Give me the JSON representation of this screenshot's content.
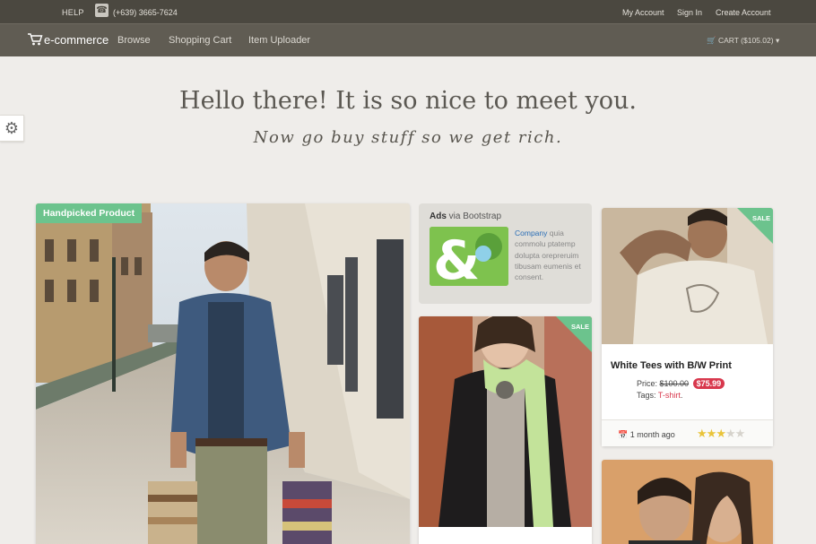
{
  "topbar": {
    "help": "HELP",
    "phone_icon": "phone-icon",
    "phone": "(+639) 3665-7624",
    "links": [
      "My Account",
      "Sign In",
      "Create Account"
    ]
  },
  "navbar": {
    "brand": "e-commerce",
    "brand_icon": "shopping-cart-icon",
    "links": [
      "Browse",
      "Shopping Cart",
      "Item Uploader"
    ],
    "cart": "CART ($105.02)"
  },
  "settings_icon": "gear-icon",
  "hero": {
    "title": "Hello there! It is so nice to meet you.",
    "subtitle": "Now go buy stuff so we get rich."
  },
  "featured": {
    "ribbon": "Handpicked Product"
  },
  "ads": {
    "label_bold": "Ads",
    "label_rest": " via Bootstrap",
    "company": "Company",
    "text": " quia commolu ptatemp dolupta orepreruim tibusam eumenis et consent."
  },
  "product_woman": {
    "sale": "SALE"
  },
  "product_tee": {
    "sale": "SALE",
    "name": "White Tees with B/W Print",
    "price_label": "Price:",
    "old_price": "$100.00",
    "new_price": "$75.99",
    "tags_label": "Tags:",
    "tag": "T-shirt",
    "tag_suffix": ".",
    "time": "1 month ago",
    "rating": 3,
    "rating_max": 5
  },
  "colors": {
    "topbar": "#4b4840",
    "navbar": "#605c53",
    "accent_green": "#6cc38d",
    "sale_red": "#d8384d",
    "link_blue": "#2a6eb6",
    "star": "#e9c43a"
  }
}
